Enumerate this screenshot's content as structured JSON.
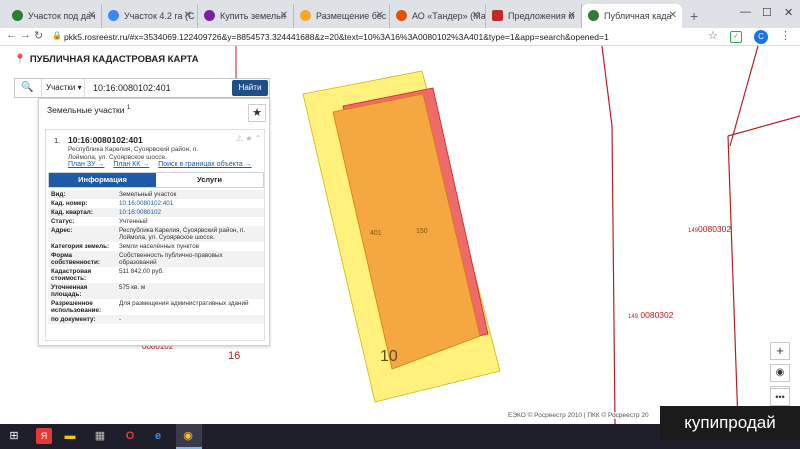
{
  "browser": {
    "tabs": [
      {
        "label": "Участок под дач",
        "color": "#2e7d32"
      },
      {
        "label": "Участок 4.2 га (С",
        "color": "#4285f4"
      },
      {
        "label": "Купить земельн",
        "color": "#7b1fa2"
      },
      {
        "label": "Размещение бес",
        "color": "#f9a825"
      },
      {
        "label": "АО «Тандер» (Ма",
        "color": "#e65100"
      },
      {
        "label": "Предложения м",
        "color": "#c62828"
      },
      {
        "label": "Публичная када",
        "color": "#2e7d32"
      }
    ],
    "new_tab": "+",
    "url": "pkk5.rosreestr.ru/#x=3534069.122409726&y=8854573.324441688&z=20&text=10%3A16%3A0080102%3A401&type=1&app=search&opened=1",
    "avatar_letter": "C"
  },
  "app": {
    "title": "ПУБЛИЧНАЯ КАДАСТРОВАЯ КАРТА",
    "search": {
      "type_label": "Участки",
      "value": "10:16:0080102:401",
      "button": "Найти"
    },
    "panel": {
      "title": "Земельные участки",
      "count_sup": "1",
      "item": {
        "index": "1.",
        "cad_number": "10:16:0080102:401",
        "address_short": "Республика Карелия, Суоярвский район, п. Лоймола, ул. Суоярвское шоссе.",
        "links": [
          "План ЗУ →",
          "План КК →",
          "Поиск в границах объекта →"
        ]
      },
      "tabs": {
        "info": "Информация",
        "services": "Услуги"
      },
      "rows": [
        {
          "k": "Вид:",
          "v": "Земельный участок"
        },
        {
          "k": "Кад. номер:",
          "v": "10:16:0080102:401"
        },
        {
          "k": "Кад. квартал:",
          "v": "10:16:0080102"
        },
        {
          "k": "Статус:",
          "v": "Учтенный"
        },
        {
          "k": "Адрес:",
          "v": "Республика Карелия, Суоярвский район, п. Лоймола, ул. Суоярвское шоссе."
        },
        {
          "k": "Категория земель:",
          "v": "Земли населённых пунктов"
        },
        {
          "k": "Форма собственности:",
          "v": "Собственность публично-правовых образований"
        },
        {
          "k": "Кадастровая стоимость:",
          "v": "511 842,00 руб."
        },
        {
          "k": "Уточненная площадь:",
          "v": "575 кв. м"
        },
        {
          "k": "Разрешенное использование:",
          "v": "Для размещения административных зданий"
        },
        {
          "k": "по документу:",
          "v": "-"
        }
      ]
    }
  },
  "map": {
    "label_16": "16",
    "label_10": "10",
    "plot_label_a": "401",
    "plot_label_b": "150",
    "q1_prefix": "149",
    "q1": "0080302",
    "q2_prefix": "149",
    "q2": "0080302",
    "partial_label": "0080102",
    "credits": "ЕЭКО © Росреестр 2010 | ПКК © Росреестр 20",
    "zoom_in": "+",
    "zoom_out": "−",
    "colors": {
      "yellow": "#fff176",
      "orange": "#f5a742",
      "red": "#f06a6a",
      "border": "#b22222"
    }
  },
  "taskbar": {
    "date": "24.11.2019"
  },
  "watermark": "купипродай"
}
